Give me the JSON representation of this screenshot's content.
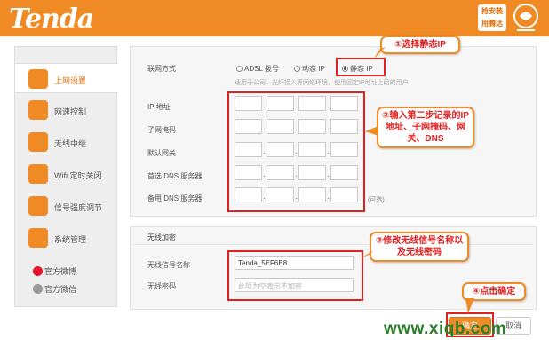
{
  "header": {
    "logo": "Tenda",
    "badge_line1": "抢安装",
    "badge_line2": "用腾达"
  },
  "sidebar": {
    "items": [
      {
        "label": "上网设置",
        "active": true
      },
      {
        "label": "网速控制"
      },
      {
        "label": "无线中继"
      },
      {
        "label": "Wifi 定时关闭"
      },
      {
        "label": "信号强度调节"
      },
      {
        "label": "系统管理"
      }
    ],
    "social": [
      {
        "label": "官方微博"
      },
      {
        "label": "官方微信"
      }
    ]
  },
  "internet": {
    "mode_label": "联网方式",
    "modes": [
      {
        "label": "ADSL 拨号",
        "selected": false
      },
      {
        "label": "动态 IP",
        "selected": false
      },
      {
        "label": "静态 IP",
        "selected": true
      }
    ],
    "mode_hint": "适用于公司、光纤接入等网络环境，使用固定IP地址上网的用户",
    "fields": [
      {
        "label": "IP 地址"
      },
      {
        "label": "子网掩码"
      },
      {
        "label": "默认网关"
      },
      {
        "label": "首选 DNS 服务器"
      },
      {
        "label": "备用 DNS 服务器",
        "suffix": "(可选)"
      }
    ]
  },
  "wireless": {
    "section_title": "无线加密",
    "ssid_label": "无线信号名称",
    "ssid_value": "Tenda_5EF6B8",
    "password_label": "无线密码",
    "password_placeholder": "此项为空表示不加密"
  },
  "callouts": {
    "step1": "①选择静态IP",
    "step2": "②输入第二步记录的IP地址、子网掩码、网关、DNS",
    "step3": "③修改无线信号名称以及无线密码",
    "step4": "④点击确定"
  },
  "buttons": {
    "ok": "确定",
    "cancel": "取消"
  },
  "watermark": "www.xiqb.com",
  "colors": {
    "brand_orange": "#f08a24",
    "annotation_red": "#e02020"
  }
}
